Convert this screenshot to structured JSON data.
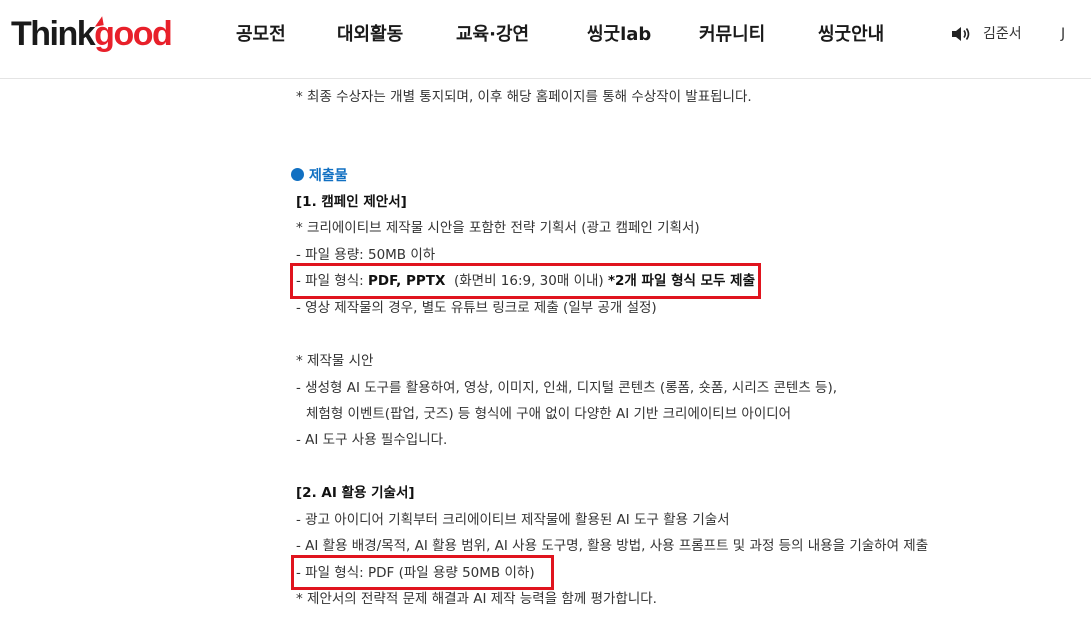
{
  "header": {
    "logo": {
      "part1": "Think",
      "part2": "good"
    },
    "nav": [
      "공모전",
      "대외활동",
      "교육·강연",
      "씽굿lab",
      "커뮤니티",
      "씽굿안내"
    ],
    "user_name": "김준서",
    "user_initial": "J",
    "speaker_icon": "speaker-icon"
  },
  "content": {
    "notice": "* 최종 수상자는 개별 통지되며, 이후 해당 홈페이지를 통해 수상작이 발표됩니다.",
    "section_title": "제출물",
    "part1": {
      "title": "[1. 캠페인 제안서]",
      "desc": "* 크리에이티브 제작물 시안을 포함한 전략 기획서 (광고 캠페인 기획서)",
      "size": "- 파일 용량: 50MB 이하",
      "format_prefix": "- 파일 형식: ",
      "format_bold": "PDF, PPTX",
      "format_mid": "  (화면비 16:9, 30매 이내) ",
      "format_note": "*2개 파일 형식 모두 제출",
      "video": "- 영상 제작물의 경우, 별도 유튜브 링크로 제출 (일부 공개 설정)",
      "draft_title": "* 제작물 시안",
      "draft_line1": "- 생성형 AI 도구를 활용하여, 영상, 이미지, 인쇄, 디지털 콘텐츠 (롱폼, 숏폼, 시리즈 콘텐츠 등),",
      "draft_line2": "체험형 이벤트(팝업, 굿즈) 등 형식에 구애 없이 다양한 AI 기반 크리에이티브 아이디어",
      "ai_required": "- AI 도구 사용 필수입니다."
    },
    "part2": {
      "title": "[2. AI 활용 기술서]",
      "line1": "- 광고 아이디어 기획부터 크리에이티브 제작물에 활용된 AI 도구 활용 기술서",
      "line2": "- AI 활용 배경/목적, AI 활용 범위, AI 사용 도구명, 활용 방법, 사용 프롬프트 및 과정 등의 내용을 기술하여 제출",
      "format": "- 파일 형식: PDF (파일 용량 50MB 이하)",
      "eval": "* 제안서의 전략적 문제 해결과 AI 제작 능력을 함께 평가합니다."
    }
  },
  "colors": {
    "brand_red": "#e8202a",
    "accent_blue": "#1170c2",
    "highlight_red": "#e0141e"
  }
}
